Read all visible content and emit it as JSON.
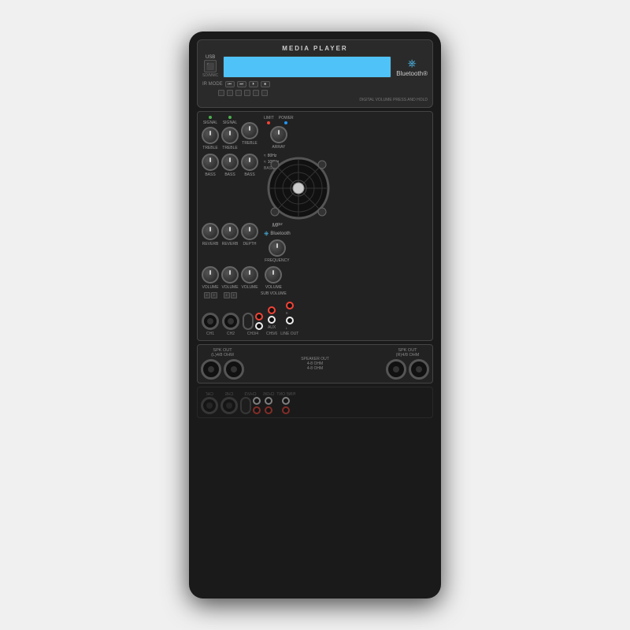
{
  "device": {
    "title": "MEDIA PLAYER",
    "bluetooth_label": "Bluetooth®",
    "usb_label": "USB",
    "ir_label": "IR MODE",
    "sections": {
      "mixer": {
        "signal_label": "SIGNAL",
        "treble_label": "TREBLE",
        "bass_label": "BASS",
        "reverb_label": "REVERB",
        "depth_label": "DEPTH",
        "volume_label": "VOLUME",
        "array_label": "ARRAY",
        "limit_label": "LIMIT",
        "power_label": "POWER",
        "bass_boost_label": "BASS BOOST",
        "frequency_label": "FREQUENCY",
        "sub_volume_label": "SUB VOLUME",
        "mp3_label": "MP³",
        "channels": [
          "CH1",
          "CH2",
          "CH3/4",
          "CH5/6",
          "LINE OUT"
        ],
        "spk_left": "SPK OUT\n(L)4/8 OHM",
        "spk_right": "SPK OUT\n(R)4/8 OHM",
        "aux_label": "AUX"
      }
    }
  }
}
